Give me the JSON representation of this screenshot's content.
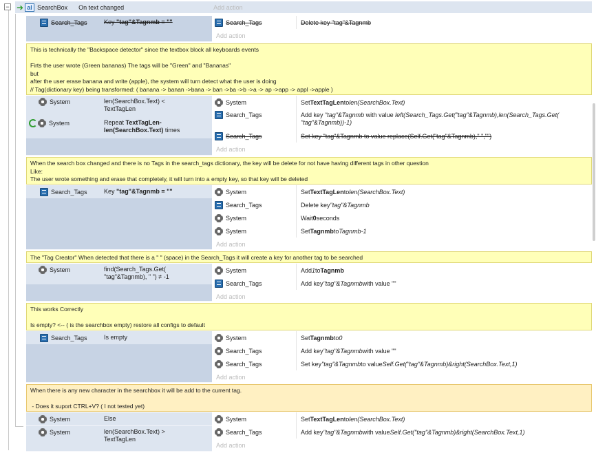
{
  "header": {
    "object": "SearchBox",
    "condition": "On text changed",
    "add_action": "Add action"
  },
  "event1": {
    "cond_object": "Search_Tags",
    "cond_prefix": "Key ",
    "cond_b": "\"tag\"&Tagnmb = \"\"",
    "action_object": "Search_Tags",
    "action_text": "Delete key \"tag\"&Tagnmb"
  },
  "add_action": "Add action",
  "comment1": "This is technically the \"Backspace detector\" since the textbox block all keyboards events\n\nFirts the user wrote (Green bananas) The tags will be \"Green\" and \"Bananas\"\nbut\nafter the user erase banana and write (apple), the system will turn detect what the user is doing\n// Tag(dictionary key) being transformed: ( banana -> banan ->bana -> ban ->ba ->b ->a -> ap ->app -> appl ->apple )",
  "event2": {
    "c1_object": "System",
    "c1_text": "len(SearchBox.Text) < TextTagLen",
    "c2_object": "System",
    "c2_text_a": "Repeat ",
    "c2_text_b": "TextTagLen-len(SearchBox.Text)",
    "c2_text_c": " times",
    "a1_object": "System",
    "a1_pre": "Set ",
    "a1_b": "TextTagLen",
    "a1_mid": " to ",
    "a1_i": "len(SearchBox.Text)",
    "a2_object": "Search_Tags",
    "a2_pre": "Add key ",
    "a2_i1": "\"tag\"&Tagnmb",
    "a2_mid": " with value ",
    "a2_i2": "left(Search_Tags.Get(\"tag\"&Tagnmb),len(Search_Tags.Get(",
    "a2_i3": "\"tag\"&Tagnmb))-1)",
    "a3_object": "Search_Tags",
    "a3_text": "Set key \"tag\"&Tagnmb to value replace(Self.Get(\"tag\"&Tagnmb),\" \",\"\")"
  },
  "comment2": "When the search box changed and there is no Tags in the search_tags dictionary, the key will be delete for not have having different tags in other question\nLike:\nThe user wrote something and erase that completely, it will turn into a empty key, so that key will be deleted",
  "event3": {
    "cond_object": "Search_Tags",
    "cond_prefix": "Key ",
    "cond_b": "\"tag\"&Tagnmb = \"\"",
    "a1_object": "System",
    "a1_pre": "Set ",
    "a1_b": "TextTagLen",
    "a1_mid": " to ",
    "a1_i": "len(SearchBox.Text)",
    "a2_object": "Search_Tags",
    "a2_pre": "Delete key ",
    "a2_i": "\"tag\"&Tagnmb",
    "a3_object": "System",
    "a3_pre": "Wait ",
    "a3_b": "0",
    "a3_post": " seconds",
    "a4_object": "System",
    "a4_pre": "Set ",
    "a4_b": "Tagnmb",
    "a4_mid": " to ",
    "a4_i": "Tagnmb-1"
  },
  "comment3": "The \"Tag Creator\" When detected that there is a \" \" (space) in the Search_Tags it will create a key for another tag to be searched",
  "event4": {
    "cond_object": "System",
    "cond_text": "find(Search_Tags.Get( \"tag\"&Tagnmb), \" \") ≠ -1",
    "a1_object": "System",
    "a1_pre": "Add ",
    "a1_i": "1",
    "a1_mid": " to ",
    "a1_b": "Tagnmb",
    "a2_object": "Search_Tags",
    "a2_pre": "Add key ",
    "a2_i": "\"tag\"&Tagnmb",
    "a2_post": " with value \"\""
  },
  "comment4": "This works Correctly\n\nIs empty? <-- ( is the searchbox empty) restore all configs to default",
  "event5": {
    "cond_object": "Search_Tags",
    "cond_text": "Is empty",
    "a1_object": "System",
    "a1_pre": "Set ",
    "a1_b": "Tagnmb",
    "a1_mid": " to ",
    "a1_i": "0",
    "a2_object": "Search_Tags",
    "a2_pre": "Add key ",
    "a2_i": "\"tag\"&Tagnmb",
    "a2_post": " with value \"\"",
    "a3_object": "Search_Tags",
    "a3_pre": "Set key ",
    "a3_i1": "\"tag\"&Tagnmb",
    "a3_mid": " to value ",
    "a3_i2": "Self.Get(\"tag\"&Tagnmb)&right(SearchBox.Text,1)"
  },
  "comment5": "When there is any new character in the searchbox it will be add to the current tag.\n\n - Does it suport CTRL+V? ( I not tested yet)",
  "event6": {
    "c1_object": "System",
    "c1_text": "Else",
    "c2_object": "System",
    "c2_text": "len(SearchBox.Text) > TextTagLen",
    "a1_object": "System",
    "a1_pre": "Set ",
    "a1_b": "TextTagLen",
    "a1_mid": " to ",
    "a1_i": "len(SearchBox.Text)",
    "a2_object": "Search_Tags",
    "a2_pre": "Add key ",
    "a2_i1": "\"tag\"&Tagnmb",
    "a2_mid": " with value ",
    "a2_i2": "Self.Get(\"tag\"&Tagnmb)&right(SearchBox.Text,1)"
  }
}
